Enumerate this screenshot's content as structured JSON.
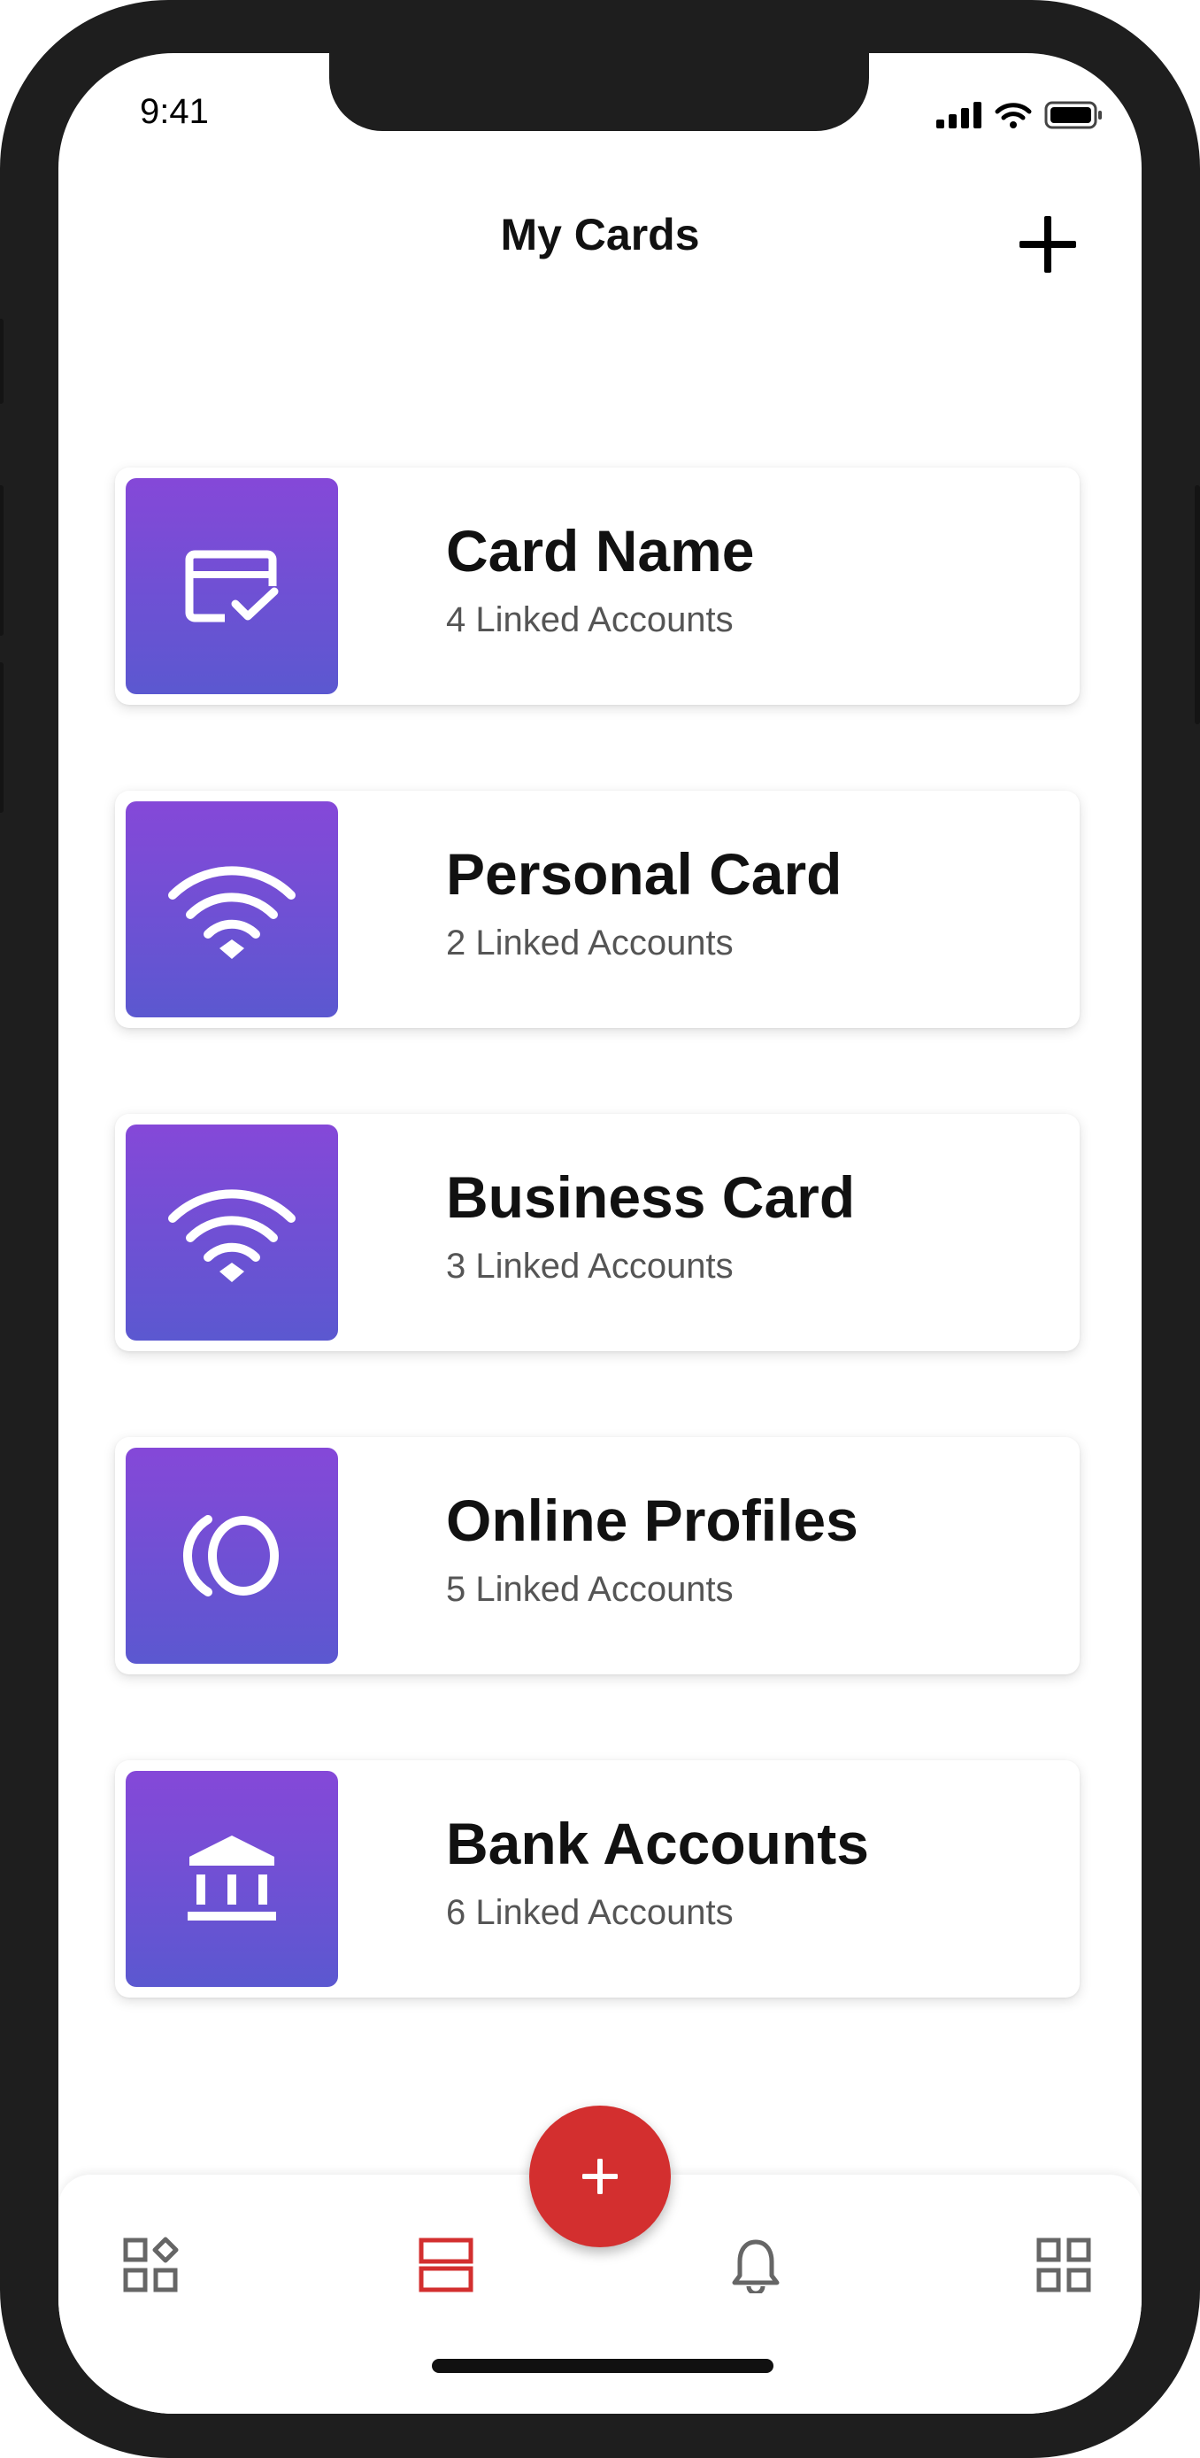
{
  "status_bar": {
    "time": "9:41"
  },
  "header": {
    "title": "My Cards"
  },
  "cards": [
    {
      "name": "Card Name",
      "subtitle": "4 Linked Accounts",
      "icon": "card-check-icon"
    },
    {
      "name": "Personal Card",
      "subtitle": "2 Linked Accounts",
      "icon": "wifi-icon"
    },
    {
      "name": "Business Card",
      "subtitle": "3 Linked Accounts",
      "icon": "wifi-icon"
    },
    {
      "name": "Online Profiles",
      "subtitle": "5 Linked Accounts",
      "icon": "profile-rings-icon"
    },
    {
      "name": "Bank Accounts",
      "subtitle": "6 Linked Accounts",
      "icon": "bank-icon"
    }
  ],
  "fab": {
    "icon": "plus-icon",
    "color": "#d32f2f"
  },
  "tab_bar": {
    "tabs": [
      {
        "icon": "widgets-icon",
        "active": false
      },
      {
        "icon": "cards-icon",
        "active": true
      },
      {
        "icon": "bell-icon",
        "active": false
      },
      {
        "icon": "grid-icon",
        "active": false
      }
    ]
  },
  "colors": {
    "accent": "#d32f2f",
    "tile_top": "#8548d8",
    "tile_bottom": "#5b58d0",
    "frame": "#1e1e1e"
  }
}
